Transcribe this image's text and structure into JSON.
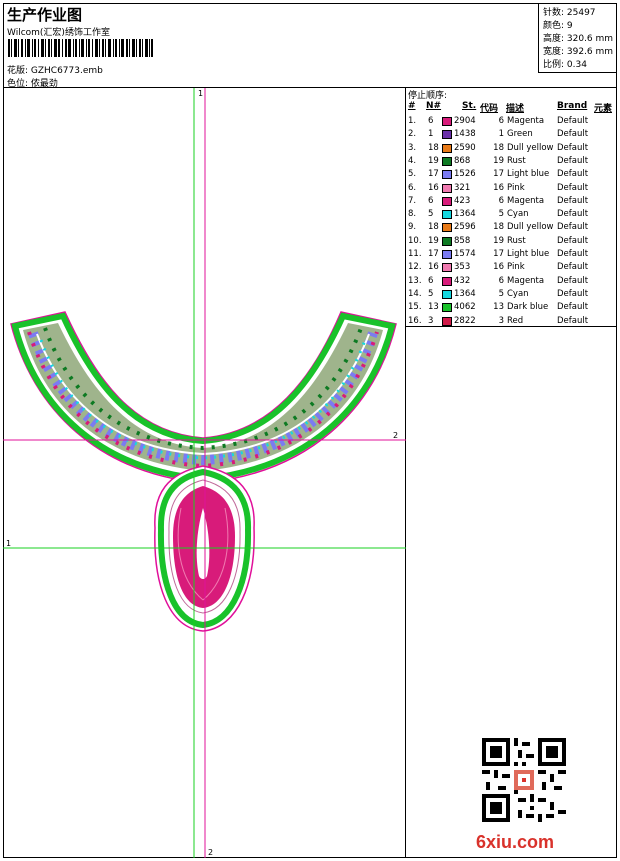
{
  "header": {
    "title": "生产作业图",
    "studio": "Wilcom(汇宏)绣饰工作室",
    "filename": "花版: GZHC6773.emb",
    "colorway": "色位: 侬最劲"
  },
  "stats": {
    "stitches": "针数: 25497",
    "colors": "颜色: 9",
    "height": "高度: 320.6 mm",
    "width": "宽度: 392.6 mm",
    "scale": "比例: 0.34"
  },
  "sequence": {
    "title": "停止顺序:",
    "headers": {
      "num": "#",
      "needle": "N#",
      "st": "St.",
      "code": "代码",
      "desc": "描述",
      "brand": "Brand",
      "element": "元素"
    },
    "rows": [
      {
        "idx": "1.",
        "n": "6",
        "swatch": "#d81b7a",
        "st": "2904",
        "code": "6",
        "desc": "Magenta",
        "brand": "Default"
      },
      {
        "idx": "2.",
        "n": "1",
        "swatch": "#6a2fa8",
        "st": "1438",
        "code": "1",
        "desc": "Green",
        "brand": "Default"
      },
      {
        "idx": "3.",
        "n": "18",
        "swatch": "#e87a18",
        "st": "2590",
        "code": "18",
        "desc": "Dull yellow",
        "brand": "Default"
      },
      {
        "idx": "4.",
        "n": "19",
        "swatch": "#0d7a22",
        "st": "868",
        "code": "19",
        "desc": "Rust",
        "brand": "Default"
      },
      {
        "idx": "5.",
        "n": "17",
        "swatch": "#7b7bf2",
        "st": "1526",
        "code": "17",
        "desc": "Light blue",
        "brand": "Default"
      },
      {
        "idx": "6.",
        "n": "16",
        "swatch": "#f07ab0",
        "st": "321",
        "code": "16",
        "desc": "Pink",
        "brand": "Default"
      },
      {
        "idx": "7.",
        "n": "6",
        "swatch": "#d81b7a",
        "st": "423",
        "code": "6",
        "desc": "Magenta",
        "brand": "Default"
      },
      {
        "idx": "8.",
        "n": "5",
        "swatch": "#16d8e0",
        "st": "1364",
        "code": "5",
        "desc": "Cyan",
        "brand": "Default"
      },
      {
        "idx": "9.",
        "n": "18",
        "swatch": "#e87a18",
        "st": "2596",
        "code": "18",
        "desc": "Dull yellow",
        "brand": "Default"
      },
      {
        "idx": "10.",
        "n": "19",
        "swatch": "#0d7a22",
        "st": "858",
        "code": "19",
        "desc": "Rust",
        "brand": "Default"
      },
      {
        "idx": "11.",
        "n": "17",
        "swatch": "#7b7bf2",
        "st": "1574",
        "code": "17",
        "desc": "Light blue",
        "brand": "Default"
      },
      {
        "idx": "12.",
        "n": "16",
        "swatch": "#f07ab0",
        "st": "353",
        "code": "16",
        "desc": "Pink",
        "brand": "Default"
      },
      {
        "idx": "13.",
        "n": "6",
        "swatch": "#d81b7a",
        "st": "432",
        "code": "6",
        "desc": "Magenta",
        "brand": "Default"
      },
      {
        "idx": "14.",
        "n": "5",
        "swatch": "#16d8e0",
        "st": "1364",
        "code": "5",
        "desc": "Cyan",
        "brand": "Default"
      },
      {
        "idx": "15.",
        "n": "13",
        "swatch": "#19c22a",
        "st": "4062",
        "code": "13",
        "desc": "Dark blue",
        "brand": "Default"
      },
      {
        "idx": "16.",
        "n": "3",
        "swatch": "#d01a48",
        "st": "2822",
        "code": "3",
        "desc": "Red",
        "brand": "Default"
      }
    ]
  },
  "guides": {
    "h1": "1",
    "h2": "2",
    "v1": "1",
    "v2": "2",
    "color_green": "#19d020",
    "color_magenta": "#e0109a"
  },
  "watermark": {
    "logo_text": "6xiu.com",
    "qr_icon": "qr-code-icon"
  }
}
